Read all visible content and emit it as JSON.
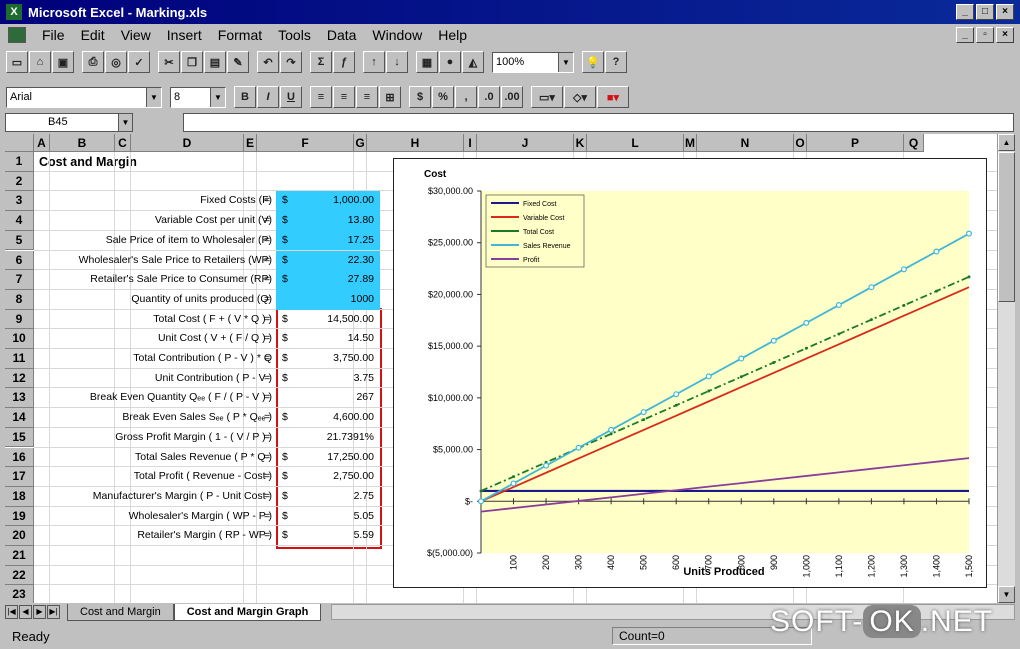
{
  "window": {
    "title": "Microsoft Excel - Marking.xls"
  },
  "menu": [
    "File",
    "Edit",
    "View",
    "Insert",
    "Format",
    "Tools",
    "Data",
    "Window",
    "Help"
  ],
  "toolbar": {
    "zoom": "100%",
    "font": "Arial",
    "size": "8"
  },
  "formula_bar": {
    "name_box": "B45",
    "content": ""
  },
  "columns": [
    "A",
    "B",
    "C",
    "D",
    "E",
    "F",
    "G",
    "H",
    "I",
    "J",
    "K",
    "L",
    "M",
    "N",
    "O",
    "P",
    "Q"
  ],
  "rows": [
    "1",
    "2",
    "3",
    "4",
    "5",
    "6",
    "7",
    "8",
    "9",
    "10",
    "11",
    "12",
    "13",
    "14",
    "15",
    "16",
    "17",
    "18",
    "19",
    "20",
    "21",
    "22",
    "23"
  ],
  "sheet": {
    "title": "Cost and Margin",
    "items": [
      {
        "label": "Fixed Costs (F)",
        "dollar": "$",
        "value": "1,000.00"
      },
      {
        "label": "Variable Cost per unit (V)",
        "dollar": "$",
        "value": "13.80"
      },
      {
        "label": "Sale Price of item to Wholesaler (P)",
        "dollar": "$",
        "value": "17.25"
      },
      {
        "label": "Wholesaler's Sale Price to Retailers (WP)",
        "dollar": "$",
        "value": "22.30"
      },
      {
        "label": "Retailer's Sale Price to Consumer (RP)",
        "dollar": "$",
        "value": "27.89"
      },
      {
        "label": "Quantity of units produced (Q)",
        "dollar": "",
        "value": "1000"
      },
      {
        "label": "Total Cost ( F + ( V * Q ) )",
        "dollar": "$",
        "value": "14,500.00"
      },
      {
        "label": "Unit Cost ( V + ( F / Q ) )",
        "dollar": "$",
        "value": "14.50"
      },
      {
        "label": "Total Contribution ( P - V ) * Q",
        "dollar": "$",
        "value": "3,750.00"
      },
      {
        "label": "Unit Contribution ( P - V )",
        "dollar": "$",
        "value": "3.75"
      },
      {
        "label": "Break Even Quantity Qₑₑ ( F / ( P - V ) )",
        "dollar": "",
        "value": "267"
      },
      {
        "label": "Break Even Sales Sₑₑ ( P * Qₑₑ )",
        "dollar": "$",
        "value": "4,600.00"
      },
      {
        "label": "Gross Profit Margin ( 1 - ( V / P ) )",
        "dollar": "",
        "value": "21.7391%"
      },
      {
        "label": "Total Sales Revenue ( P * Q )",
        "dollar": "$",
        "value": "17,250.00"
      },
      {
        "label": "Total Profit ( Revenue - Cost )",
        "dollar": "$",
        "value": "2,750.00"
      },
      {
        "label": "Manufacturer's Margin ( P - Unit Cost )",
        "dollar": "$",
        "value": "2.75"
      },
      {
        "label": "Wholesaler's Margin ( WP - P )",
        "dollar": "$",
        "value": "5.05"
      },
      {
        "label": "Retailer's Margin ( RP - WP )",
        "dollar": "$",
        "value": "5.59"
      }
    ],
    "equals": "="
  },
  "chart_data": {
    "type": "line",
    "title": "Cost",
    "xlabel": "Units Produced",
    "ylabel": "",
    "x": [
      0,
      100,
      200,
      300,
      400,
      500,
      600,
      700,
      800,
      900,
      1000,
      1100,
      1200,
      1300,
      1400,
      1500
    ],
    "x_ticks": [
      "100",
      "200",
      "300",
      "400",
      "500",
      "600",
      "700",
      "800",
      "900",
      "1,000",
      "1,100",
      "1,200",
      "1,300",
      "1,400",
      "1,500"
    ],
    "y_ticks": [
      "$30,000.00",
      "$25,000.00",
      "$20,000.00",
      "$15,000.00",
      "$10,000.00",
      "$5,000.00",
      "$-",
      "$(5,000.00)"
    ],
    "ylim": [
      -5000,
      30000
    ],
    "legend_position": "top-left",
    "series": [
      {
        "name": "Fixed Cost",
        "color": "#1a1a8c",
        "values": [
          1000,
          1000,
          1000,
          1000,
          1000,
          1000,
          1000,
          1000,
          1000,
          1000,
          1000,
          1000,
          1000,
          1000,
          1000,
          1000
        ]
      },
      {
        "name": "Variable Cost",
        "color": "#d92b1a",
        "values": [
          0,
          1380,
          2760,
          4140,
          5520,
          6900,
          8280,
          9660,
          11040,
          12420,
          13800,
          15180,
          16560,
          17940,
          19320,
          20700
        ]
      },
      {
        "name": "Total Cost",
        "color": "#1a7a2a",
        "values": [
          1000,
          2380,
          3760,
          5140,
          6520,
          7900,
          9280,
          10660,
          12040,
          13420,
          14800,
          16180,
          17560,
          18940,
          20320,
          21700
        ]
      },
      {
        "name": "Sales Revenue",
        "color": "#3fb6d9",
        "values": [
          0,
          1725,
          3450,
          5175,
          6900,
          8625,
          10350,
          12075,
          13800,
          15525,
          17250,
          18975,
          20700,
          22425,
          24150,
          25875
        ]
      },
      {
        "name": "Profit",
        "color": "#8a3d9a",
        "values": [
          -1000,
          -655,
          -310,
          35,
          380,
          725,
          1070,
          1415,
          1760,
          2105,
          2450,
          2795,
          3140,
          3485,
          3830,
          4175
        ]
      }
    ]
  },
  "tabs": [
    "Cost and Margin",
    "Cost and Margin Graph"
  ],
  "status": {
    "ready": "Ready",
    "count": "Count=0"
  },
  "watermark": {
    "a": "SOFT-",
    "b": "OK",
    "c": ".NET"
  },
  "colors": {
    "cyan": "#33ccff",
    "red_border": "#d41111",
    "plot_bg": "#ffffc8"
  }
}
